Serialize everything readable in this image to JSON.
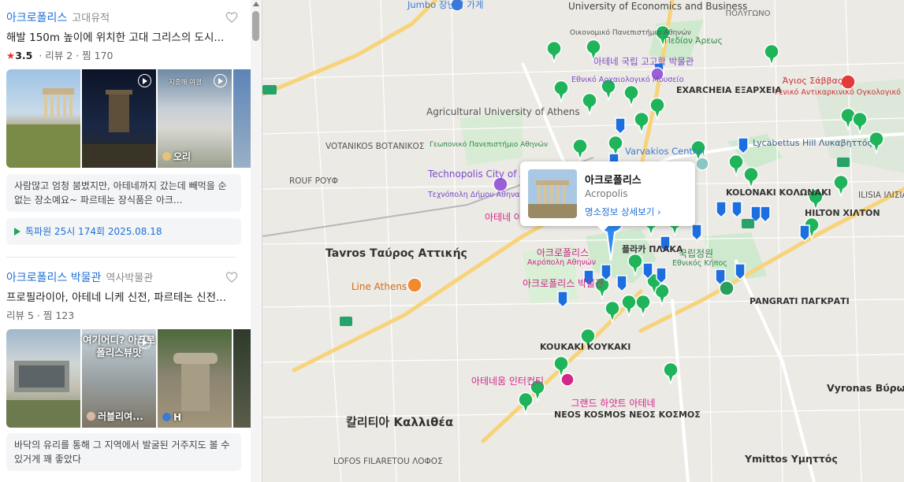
{
  "places": [
    {
      "name": "아크로폴리스",
      "category": "고대유적",
      "description": "해발 150m 높이에 위치한 고대 그리스의 도시...",
      "rating": "3.5",
      "reviews": "리뷰 2",
      "saves": "찜 170",
      "photo_labels": [
        "",
        "",
        "지중해 여행",
        ""
      ],
      "photo_author": "오리",
      "review": "사람많고 엄청 붐볐지만, 아테네까지 갔는데 빼먹을 순 없는 장소예요~ 파르테논 장식품은 아크...",
      "tip": "톡파원 25시 174회 2025.08.18"
    },
    {
      "name": "아크로폴리스 박물관",
      "category": "역사박물관",
      "description": "프로필라이아, 아테네 니케 신전, 파르테논 신전...",
      "reviews": "리뷰 5",
      "saves": "찜 123",
      "photo_labels": [
        "",
        "여기어디? 아크로폴리스뷰맛",
        "",
        ""
      ],
      "photo_authors": [
        "러블리여...",
        "H"
      ],
      "review": "바닥의 유리를 통해 그 지역에서 발굴된 거주지도 볼 수 있거게 꽤 좋았다"
    }
  ],
  "popup": {
    "name": "아크로폴리스",
    "subtitle": "Acropolis",
    "link": "명소정보 상세보기"
  },
  "map_labels": {
    "university_economics": "University of Economics and Business",
    "univ_econ_gr": "Οικονομικό Πανεπιστήμιο Αθηνών",
    "agricultural": "Agricultural University of Athens",
    "agri_gr": "Γεωπονικό Πανεπιστήμιο Αθηνών",
    "museum": "아테네 국립 고고학 박물관",
    "museum_gr": "Εθνικό Αρχαιολογικό Μουσείο",
    "pedion": "Πεδίον Άρεως",
    "exarcheia": "EXARCHEIA ΕΞΑΡΧΕΙΑ",
    "varvakios": "Varvakios Central",
    "technopolis": "Technopolis City of Athens",
    "technopolis_gr": "Τεχνόπολη Δήμου Αθηναίων",
    "votanikos": "VOTANIKOS ΒΟΤΑΝΙΚΟΣ",
    "rouf": "ROUF ΡΟΥΦ",
    "tavros": "Tavros Ταύρος Αττικής",
    "line_athens": "Line Athens",
    "agora": "아테네 아고라",
    "acropolis": "아크로폴리스",
    "acropolis_gr": "Ακρόπολη Αθηνών",
    "acropolis_museum": "아크로폴리스 박물관",
    "plaka": "플라카 ΠΛΑΚΑ",
    "national_garden": "국립정원",
    "national_garden_gr": "Εθνικός Κήπος",
    "kolonaki": "KOLONAKI ΚΟΛΩΝΑΚΙ",
    "lycabettus": "Lycabettus Hill Λυκαβηττός",
    "hilton": "HILTON ΧΙΛΤΟΝ",
    "ilisia": "ILISIA ΙΛΙΣΙΑ",
    "pangrati": "PANGRATI ΠΑΓΚΡΑΤΙ",
    "koukaki": "KOUKAKI ΚΟΥΚΑΚΙ",
    "intercontinental": "아테네움 인터컨티",
    "grand_hyatt": "그랜드 하얏트 아테네",
    "neos_kosmos": "NEOS KOSMOS ΝΕΟΣ ΚΟΣΜΟΣ",
    "kallithea": "칼리티아 Καλλιθέα",
    "lofos": "LOFOS FILARETOU ΛΟΦΟΣ",
    "vyronas": "Vyronas Βύρωνας",
    "ymittos": "Ymittos Υμηττός",
    "savvas": "Άγιος Σάββας",
    "savvas_hosp": "Γενικό Αντικαρκινικό Ογκολογικό",
    "polygono": "ΠΟΛΥΓΩΝΟ",
    "jumbo": "Jumbo 장난감 가게"
  },
  "colors": {
    "link_blue": "#1f6fd6",
    "star_red": "#e8302e",
    "pin_green": "#1fb45a",
    "pin_blue": "#1d6fe0",
    "park_green": "#c8e8c8",
    "main_road": "#f7d37a"
  }
}
